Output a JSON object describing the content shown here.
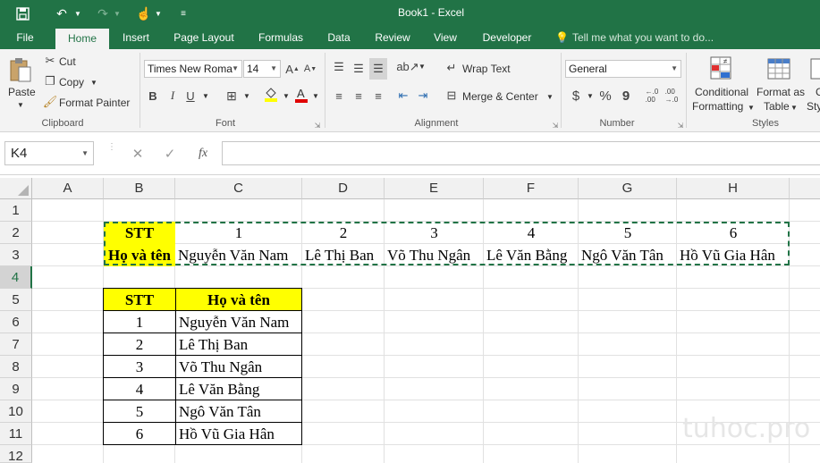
{
  "window": {
    "title": "Book1 - Excel"
  },
  "tabs": [
    "File",
    "Home",
    "Insert",
    "Page Layout",
    "Formulas",
    "Data",
    "Review",
    "View",
    "Developer"
  ],
  "active_tab": "Home",
  "tell_me": "Tell me what you want to do...",
  "clipboard": {
    "paste": "Paste",
    "cut": "Cut",
    "copy": "Copy",
    "format_painter": "Format Painter",
    "label": "Clipboard"
  },
  "font": {
    "name": "Times New Roma",
    "size": "14",
    "bold": "B",
    "italic": "I",
    "underline": "U",
    "label": "Font"
  },
  "alignment": {
    "wrap_text": "Wrap Text",
    "merge_center": "Merge & Center",
    "label": "Alignment"
  },
  "number": {
    "format": "General",
    "currency": "$",
    "percent": "%",
    "comma": "9",
    "label": "Number"
  },
  "styles": {
    "conditional": "Conditional",
    "formatting": "Formatting",
    "format_as": "Format as",
    "table": "Table",
    "cell_styles_c": "C",
    "cell_styles_sty": "Sty",
    "label": "Styles"
  },
  "formula_bar": {
    "name_box": "K4",
    "cancel": "✕",
    "enter": "✓",
    "fx": "fx",
    "value": ""
  },
  "columns": [
    "A",
    "B",
    "C",
    "D",
    "E",
    "F",
    "G",
    "H"
  ],
  "rows": [
    "1",
    "2",
    "3",
    "4",
    "5",
    "6",
    "7",
    "8",
    "9",
    "10",
    "11",
    "12"
  ],
  "selected_row": "4",
  "horizontal_table": {
    "stt_label": "STT",
    "name_label": "Họ và tên",
    "numbers": [
      "1",
      "2",
      "3",
      "4",
      "5",
      "6"
    ],
    "names": [
      "Nguyễn Văn Nam",
      "Lê Thị Ban",
      "Võ Thu Ngân",
      "Lê Văn Bằng",
      "Ngô Văn Tân",
      "Hồ Vũ Gia Hân"
    ]
  },
  "vertical_table": {
    "stt_header": "STT",
    "name_header": "Họ và tên",
    "rows": [
      {
        "stt": "1",
        "name": "Nguyễn Văn Nam"
      },
      {
        "stt": "2",
        "name": "Lê Thị Ban"
      },
      {
        "stt": "3",
        "name": "Võ Thu Ngân"
      },
      {
        "stt": "4",
        "name": "Lê Văn Bằng"
      },
      {
        "stt": "5",
        "name": "Ngô Văn Tân"
      },
      {
        "stt": "6",
        "name": "Hồ Vũ Gia Hân"
      }
    ]
  },
  "watermark": "tuhoc.pro",
  "colors": {
    "excel_green": "#217346",
    "highlight_yellow": "#ffff00",
    "font_red": "#e00000"
  }
}
